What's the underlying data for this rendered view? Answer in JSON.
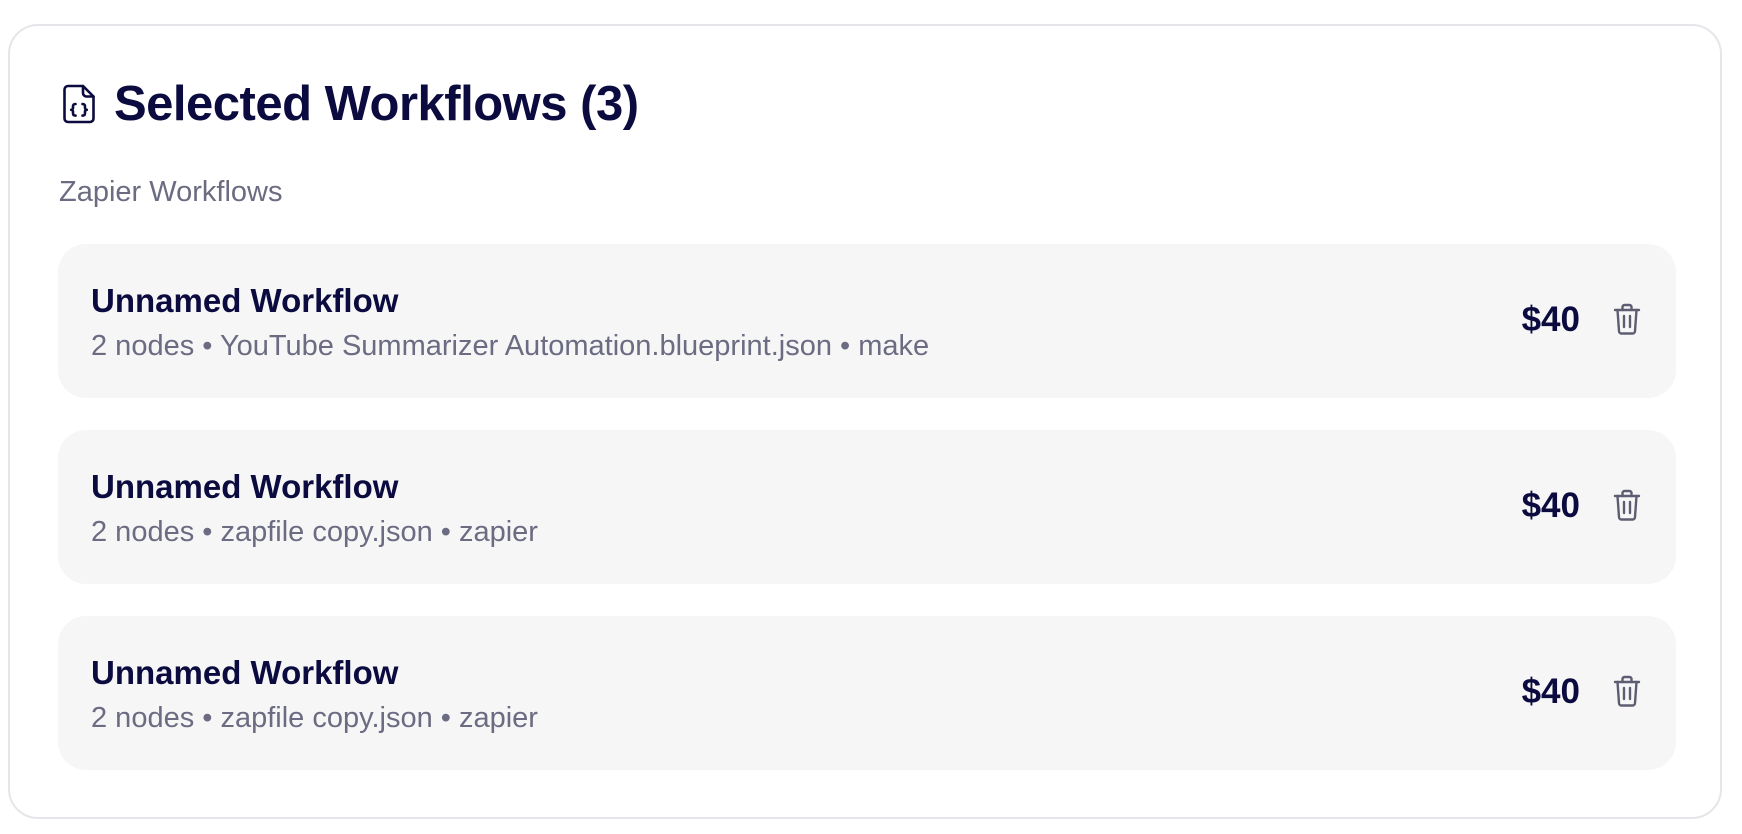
{
  "header": {
    "icon": "file-code-icon",
    "title": "Selected Workflows (3)"
  },
  "section": {
    "label": "Zapier Workflows"
  },
  "workflows": [
    {
      "name": "Unnamed Workflow",
      "meta": "2 nodes • YouTube Summarizer Automation.blueprint.json • make",
      "price": "$40",
      "delete_icon": "trash-icon"
    },
    {
      "name": "Unnamed Workflow",
      "meta": "2 nodes • zapfile copy.json • zapier",
      "price": "$40",
      "delete_icon": "trash-icon"
    },
    {
      "name": "Unnamed Workflow",
      "meta": "2 nodes • zapfile copy.json • zapier",
      "price": "$40",
      "delete_icon": "trash-icon"
    }
  ],
  "colors": {
    "title_text": "#0b0b3f",
    "muted_text": "#6b6b82",
    "item_background": "#f6f6f7",
    "card_border": "#e6e6ea"
  }
}
